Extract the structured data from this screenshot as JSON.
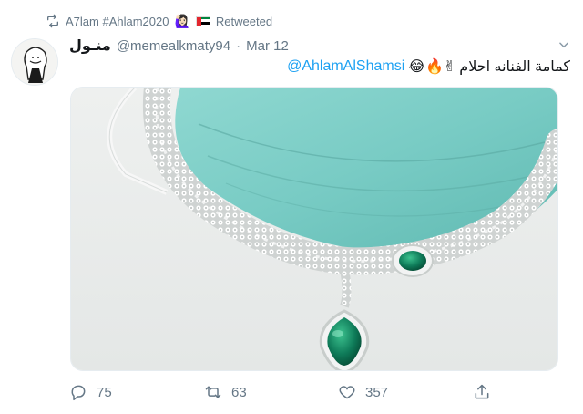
{
  "retweet_bar": {
    "text": "A7lam #Ahlam2020",
    "emoji": "🙋🏻‍♀️",
    "flag": "uae-flag",
    "status": "Retweeted"
  },
  "tweet": {
    "author_name": "منـول",
    "handle": "@memealkmaty94",
    "separator": "·",
    "date": "Mar 12",
    "mention": "@AhlamAlShamsi",
    "emojis": "✌🔥😂",
    "text_ar": "كمامة الفنانه احلام",
    "media_alt": "turquoise face mask with a diamond and emerald necklace"
  },
  "actions": {
    "replies": "75",
    "retweets": "63",
    "likes": "357"
  },
  "colors": {
    "accent": "#1da1f2",
    "muted": "#657786",
    "mask": "#7fd0c9",
    "emerald": "#0e7a58"
  }
}
